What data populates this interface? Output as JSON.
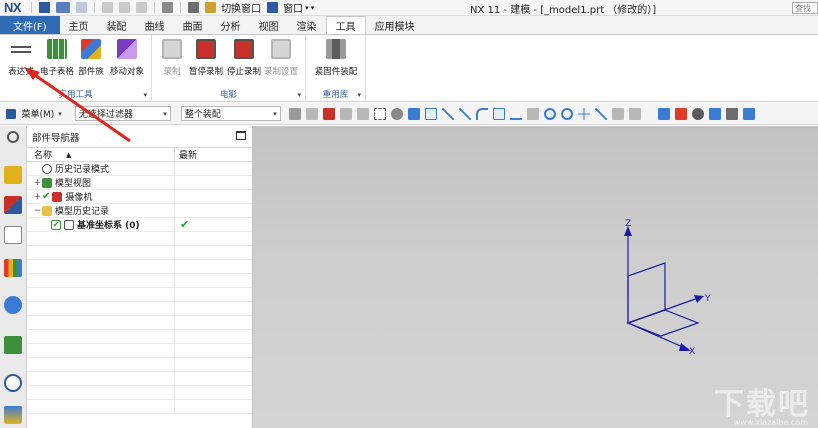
{
  "titlebar": {
    "logo": "NX",
    "switch_window": "切换窗口",
    "window_menu": "窗口",
    "title": "NX 11 - 建模 - [_model1.prt （修改的）]",
    "search_placeholder": "查找"
  },
  "menu": {
    "file": "文件(F)",
    "tabs": [
      "主页",
      "装配",
      "曲线",
      "曲面",
      "分析",
      "视图",
      "渲染",
      "工具",
      "应用模块"
    ],
    "active": "工具"
  },
  "ribbon": {
    "groups": [
      {
        "label": "实用工具",
        "buttons": [
          "表达式",
          "电子表格",
          "部件族",
          "移动对象"
        ]
      },
      {
        "label": "电影",
        "buttons": [
          "录制",
          "暂停录制",
          "停止录制",
          "录制设置"
        ]
      },
      {
        "label": "重用库",
        "buttons": [
          "紧固件装配"
        ]
      }
    ]
  },
  "selection_bar": {
    "menu": "菜单(M)",
    "type_filter": "无选择过滤器",
    "scope": "整个装配"
  },
  "navigator": {
    "title": "部件导航器",
    "col_name": "名称",
    "col_latest": "最新",
    "rows": [
      {
        "expander": "",
        "label": "历史记录模式"
      },
      {
        "expander": "+",
        "label": "模型视图"
      },
      {
        "expander": "+",
        "label": "摄像机"
      },
      {
        "expander": "−",
        "label": "模型历史记录"
      },
      {
        "expander": "",
        "label": "基准坐标系 (0)"
      }
    ]
  },
  "graphics": {
    "axis_z": "Z",
    "axis_y": "Y",
    "axis_x": "X"
  },
  "watermark": {
    "text": "下载吧",
    "url": "www.xiazaiba.com"
  },
  "colors": {
    "file_tab": "#2f6cb5",
    "group_label": "#3a5f9c",
    "csys": "#1a1aa8",
    "annotation_arrow": "#e0261c",
    "check": "#1ea41e"
  }
}
